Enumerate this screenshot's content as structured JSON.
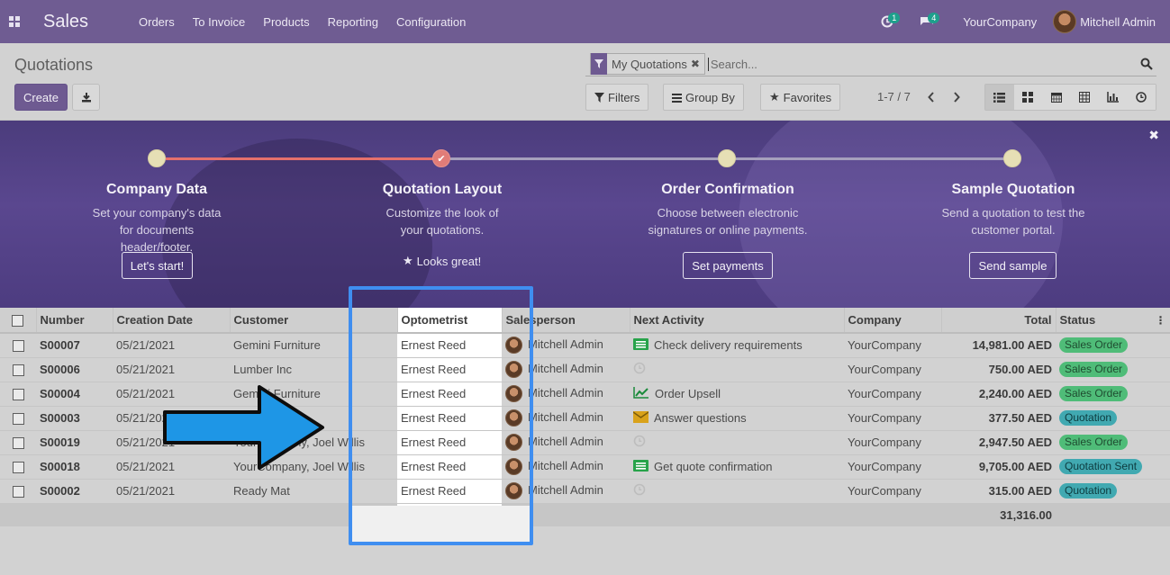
{
  "navbar": {
    "app_name": "Sales",
    "menu": [
      "Orders",
      "To Invoice",
      "Products",
      "Reporting",
      "Configuration"
    ],
    "activity_count": "1",
    "message_count": "4",
    "company": "YourCompany",
    "user": "Mitchell Admin"
  },
  "control": {
    "title": "Quotations",
    "create_label": "Create",
    "facet_label": "My Quotations",
    "search_placeholder": "Search...",
    "filters_label": "Filters",
    "groupby_label": "Group By",
    "favorites_label": "Favorites",
    "pager": "1-7 / 7"
  },
  "banner": {
    "steps": [
      {
        "title": "Company Data",
        "desc": "Set your company's data for documents header/footer.",
        "button": "Let's start!"
      },
      {
        "title": "Quotation Layout",
        "desc": "Customize the look of your quotations.",
        "done_label": "Looks great!"
      },
      {
        "title": "Order Confirmation",
        "desc": "Choose between electronic signatures or online payments.",
        "button": "Set payments"
      },
      {
        "title": "Sample Quotation",
        "desc": "Send a quotation to test the customer portal.",
        "button": "Send sample"
      }
    ]
  },
  "table": {
    "headers": [
      "Number",
      "Creation Date",
      "Customer",
      "Optometrist",
      "Salesperson",
      "Next Activity",
      "Company",
      "Total",
      "Status"
    ],
    "rows": [
      {
        "number": "S00007",
        "date": "05/21/2021",
        "customer": "Gemini Furniture",
        "optometrist": "Ernest Reed",
        "salesperson": "Mitchell Admin",
        "activity": "Check delivery requirements",
        "activity_icon": "call-icon",
        "company": "YourCompany",
        "total": "14,981.00 AED",
        "status": "Sales Order",
        "status_color": "#4fbc78"
      },
      {
        "number": "S00006",
        "date": "05/21/2021",
        "customer": "Lumber Inc",
        "optometrist": "Ernest Reed",
        "salesperson": "Mitchell Admin",
        "activity": "",
        "activity_icon": "clock-icon",
        "company": "YourCompany",
        "total": "750.00 AED",
        "status": "Sales Order",
        "status_color": "#4fbc78"
      },
      {
        "number": "S00004",
        "date": "05/21/2021",
        "customer": "Gemini Furniture",
        "optometrist": "Ernest Reed",
        "salesperson": "Mitchell Admin",
        "activity": "Order Upsell",
        "activity_icon": "chart-line-icon",
        "company": "YourCompany",
        "total": "2,240.00 AED",
        "status": "Sales Order",
        "status_color": "#4fbc78"
      },
      {
        "number": "S00003",
        "date": "05/21/2021",
        "customer": "",
        "optometrist": "Ernest Reed",
        "salesperson": "Mitchell Admin",
        "activity": "Answer questions",
        "activity_icon": "envelope-icon",
        "company": "YourCompany",
        "total": "377.50 AED",
        "status": "Quotation",
        "status_color": "#41a9b1"
      },
      {
        "number": "S00019",
        "date": "05/21/2021",
        "customer": "YourCompany, Joel Willis",
        "optometrist": "Ernest Reed",
        "salesperson": "Mitchell Admin",
        "activity": "",
        "activity_icon": "clock-icon",
        "company": "YourCompany",
        "total": "2,947.50 AED",
        "status": "Sales Order",
        "status_color": "#4fbc78"
      },
      {
        "number": "S00018",
        "date": "05/21/2021",
        "customer": "YourCompany, Joel Willis",
        "optometrist": "Ernest Reed",
        "salesperson": "Mitchell Admin",
        "activity": "Get quote confirmation",
        "activity_icon": "call-icon",
        "company": "YourCompany",
        "total": "9,705.00 AED",
        "status": "Quotation Sent",
        "status_color": "#41a9b1"
      },
      {
        "number": "S00002",
        "date": "05/21/2021",
        "customer": "Ready Mat",
        "optometrist": "Ernest Reed",
        "salesperson": "Mitchell Admin",
        "activity": "",
        "activity_icon": "clock-icon",
        "company": "YourCompany",
        "total": "315.00 AED",
        "status": "Quotation",
        "status_color": "#41a9b1"
      }
    ],
    "grand_total": "31,316.00"
  },
  "colors": {
    "navbar": "#6f5c92",
    "highlight": "#3f8ef0",
    "arrow": "#1e96e6"
  }
}
